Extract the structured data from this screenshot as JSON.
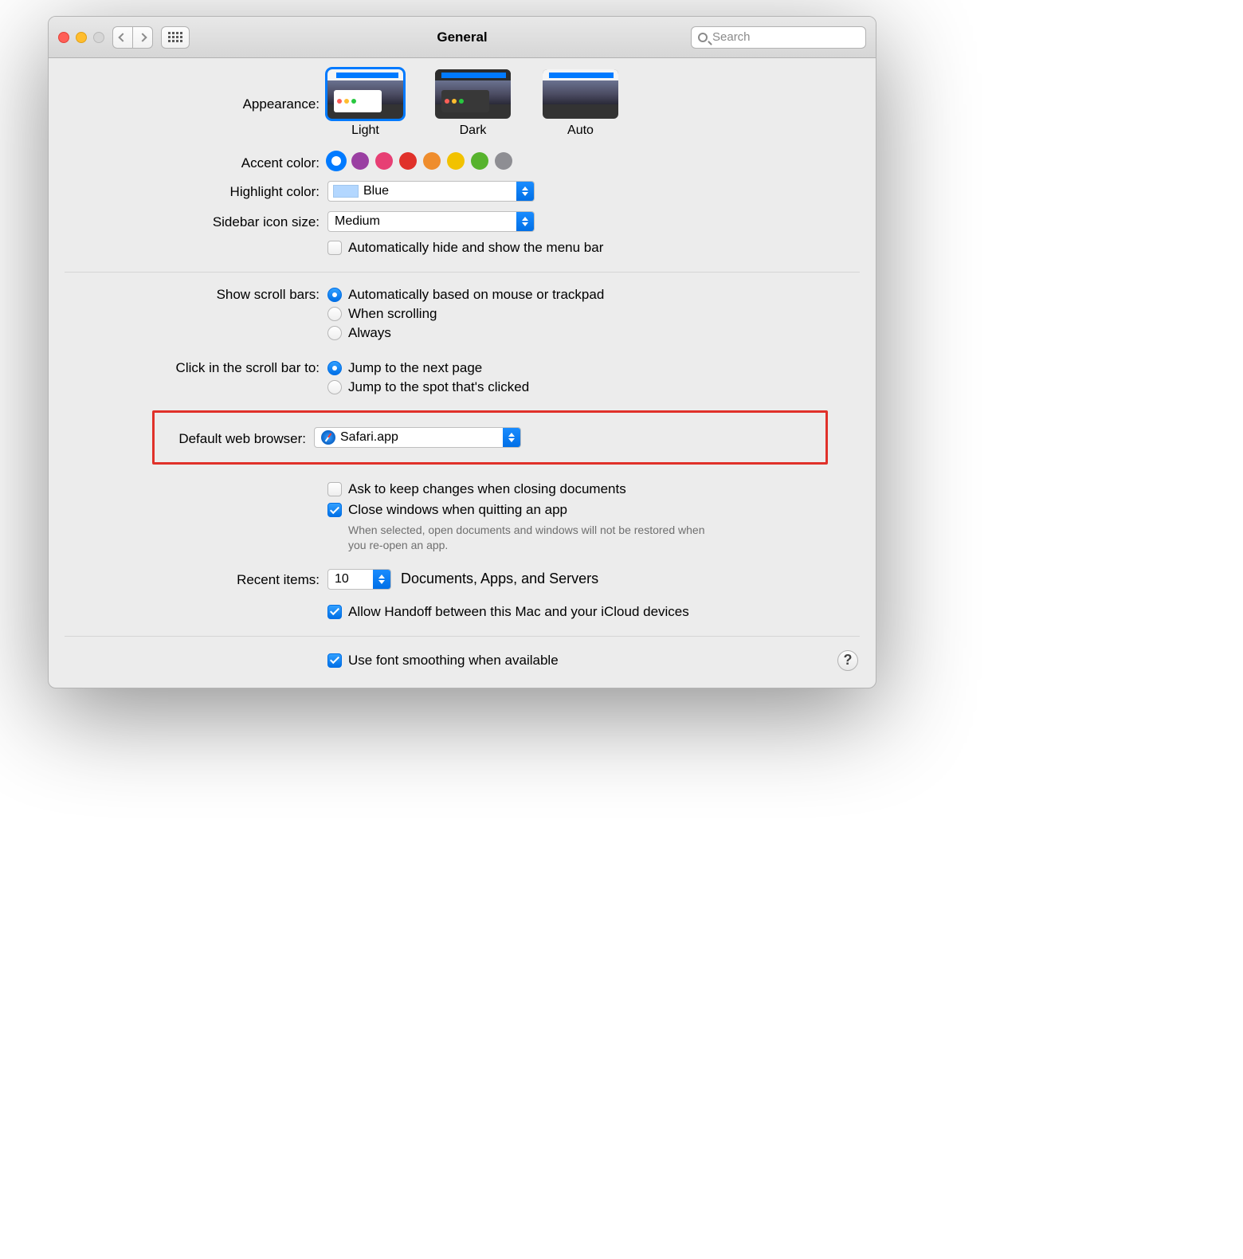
{
  "window": {
    "title": "General"
  },
  "search": {
    "placeholder": "Search"
  },
  "appearance": {
    "label": "Appearance:",
    "options": [
      "Light",
      "Dark",
      "Auto"
    ],
    "selected": "Light"
  },
  "accent_color": {
    "label": "Accent color:",
    "colors": [
      "#007aff",
      "#9a3fa2",
      "#e73f74",
      "#e0312a",
      "#ef8d2d",
      "#f2c200",
      "#57b32d",
      "#8e8e93"
    ],
    "selected_index": 0
  },
  "highlight_color": {
    "label": "Highlight color:",
    "value": "Blue",
    "swatch": "#b3d7ff"
  },
  "sidebar_icon_size": {
    "label": "Sidebar icon size:",
    "value": "Medium"
  },
  "auto_hide_menu_bar": {
    "label": "Automatically hide and show the menu bar",
    "checked": false
  },
  "scroll_bars": {
    "label": "Show scroll bars:",
    "options": [
      {
        "label": "Automatically based on mouse or trackpad",
        "checked": true
      },
      {
        "label": "When scrolling",
        "checked": false
      },
      {
        "label": "Always",
        "checked": false
      }
    ]
  },
  "click_scroll_bar": {
    "label": "Click in the scroll bar to:",
    "options": [
      {
        "label": "Jump to the next page",
        "checked": true
      },
      {
        "label": "Jump to the spot that's clicked",
        "checked": false
      }
    ]
  },
  "default_browser": {
    "label": "Default web browser:",
    "value": "Safari.app"
  },
  "ask_keep_changes": {
    "label": "Ask to keep changes when closing documents",
    "checked": false
  },
  "close_windows": {
    "label": "Close windows when quitting an app",
    "checked": true,
    "note": "When selected, open documents and windows will not be restored when you re-open an app."
  },
  "recent_items": {
    "label": "Recent items:",
    "value": "10",
    "suffix": "Documents, Apps, and Servers"
  },
  "handoff": {
    "label": "Allow Handoff between this Mac and your iCloud devices",
    "checked": true
  },
  "font_smoothing": {
    "label": "Use font smoothing when available",
    "checked": true
  },
  "help_tooltip": "?"
}
